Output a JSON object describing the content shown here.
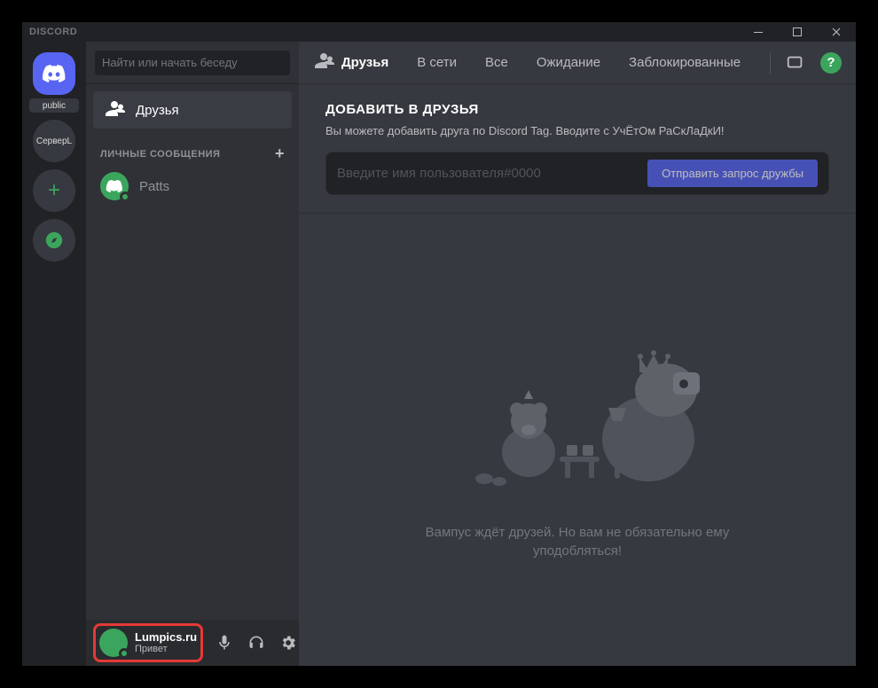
{
  "window": {
    "title": "DISCORD"
  },
  "servers": {
    "public_label": "public",
    "server1": "СерверL"
  },
  "channel_sidebar": {
    "search_placeholder": "Найти или начать беседу",
    "friends_label": "Друзья",
    "dm_header": "ЛИЧНЫЕ СООБЩЕНИЯ",
    "dm_items": [
      {
        "name": "Patts"
      }
    ]
  },
  "user_panel": {
    "name": "Lumpics.ru",
    "status": "Привет"
  },
  "main_header": {
    "title": "Друзья",
    "tabs": {
      "online": "В сети",
      "all": "Все",
      "pending": "Ожидание",
      "blocked": "Заблокированные"
    }
  },
  "add_friend": {
    "title": "ДОБАВИТЬ В ДРУЗЬЯ",
    "desc": "Вы можете добавить друга по Discord Tag. Вводите с УчЁтОм РаСкЛаДкИ!",
    "input_placeholder": "Введите имя пользователя#0000",
    "button": "Отправить запрос дружбы"
  },
  "empty_state": {
    "text": "Вампус ждёт друзей. Но вам не обязательно ему уподобляться!"
  },
  "help": "?"
}
